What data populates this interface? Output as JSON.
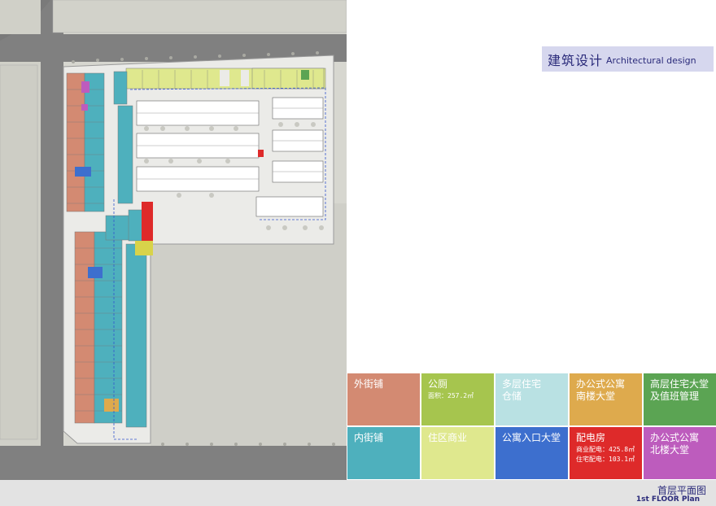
{
  "title": {
    "zh": "建筑设计",
    "en": "Architectural design"
  },
  "legend": [
    {
      "label": "外街铺",
      "sub": [],
      "color": "#d38a72"
    },
    {
      "label": "公厕",
      "sub": [
        "面积：257.2㎡"
      ],
      "color": "#a6c54e"
    },
    {
      "label": "多层住宅\n仓储",
      "sub": [],
      "color": "#b9e1e3"
    },
    {
      "label": "办公式公寓\n南楼大堂",
      "sub": [],
      "color": "#deaa4d"
    },
    {
      "label": "高层住宅大堂\n及值班管理",
      "sub": [],
      "color": "#5ba453"
    },
    {
      "label": "内街铺",
      "sub": [],
      "color": "#4eb0bd"
    },
    {
      "label": "住区商业",
      "sub": [],
      "color": "#dfe88e"
    },
    {
      "label": "公寓入口大堂",
      "sub": [],
      "color": "#3d6fce"
    },
    {
      "label": "配电房",
      "sub": [
        "商业配电：425.8㎡",
        "住宅配电：103.1㎡"
      ],
      "color": "#de2a2a"
    },
    {
      "label": "办公式公寓\n北楼大堂",
      "sub": [],
      "color": "#bd5cbd"
    }
  ],
  "footer": {
    "zh": "首层平面图",
    "en": "1st FLOOR Plan"
  }
}
